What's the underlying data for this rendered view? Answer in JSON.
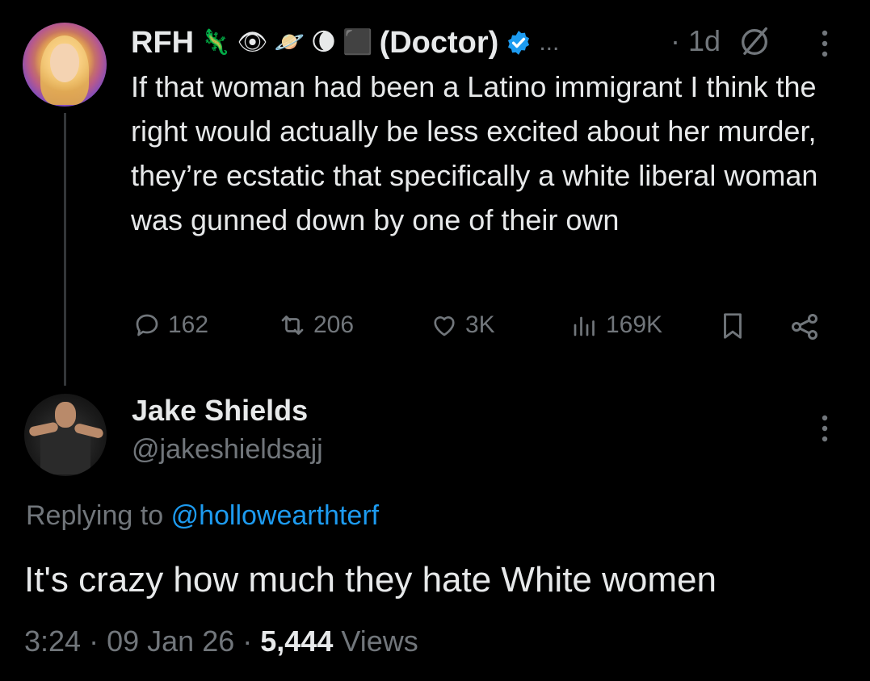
{
  "parent_tweet": {
    "author_name": "RFH",
    "emojis": [
      "🦎",
      "👁",
      "🪐",
      "🌘",
      "⬛"
    ],
    "author_title": "(Doctor)",
    "ellipsis": "...",
    "timestamp": "· 1d",
    "text": "If that woman had been a Latino immigrant I think the right would actually be less excited about her murder, they’re ecstatic that specifically a white liberal woman was gunned down by one of their own",
    "actions": {
      "replies": "162",
      "reposts": "206",
      "likes": "3K",
      "views": "169K"
    },
    "verified_color": "#1d9bf0"
  },
  "reply_tweet": {
    "author_name": "Jake Shields",
    "author_handle": "@jakeshieldsajj",
    "replying_prefix": "Replying to",
    "replying_to": "@hollowearthterf",
    "text": "It's crazy how much they hate White women",
    "time": "3:24",
    "date": "09 Jan 26",
    "views_count": "5,444",
    "views_label": "Views",
    "separator": "·"
  },
  "colors": {
    "background": "#000000",
    "text": "#e7e9ea",
    "muted": "#71767b",
    "link": "#1d9bf0"
  }
}
